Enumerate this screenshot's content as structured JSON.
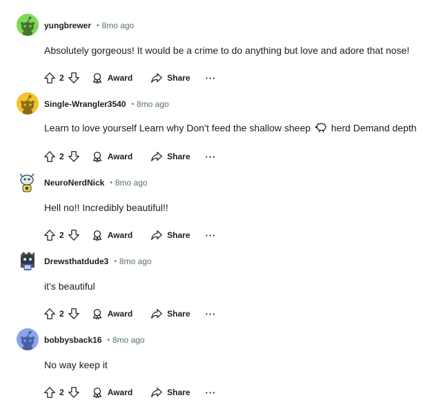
{
  "comments": [
    {
      "username": "yungbrewer",
      "separator": "•",
      "time": "8mo ago",
      "body": "Absolutely gorgeous! It would be a crime to do anything but love and adore that nose!",
      "votes": "2",
      "avatar_color": "#7ed957",
      "avatar_icon": "snoo-avatar-green"
    },
    {
      "username": "Single-Wrangler3540",
      "separator": "•",
      "time": "8mo ago",
      "body_before": "Learn to love yourself Learn why Don’t feed the shallow sheep",
      "body_icon": "sheep-emoji",
      "body_after": "herd Demand depth",
      "votes": "2",
      "avatar_color": "#f2c230",
      "avatar_icon": "snoo-avatar-yellow"
    },
    {
      "username": "NeuroNerdNick",
      "separator": "•",
      "time": "8mo ago",
      "body": "Hell no!! Incredibly beautiful!!",
      "votes": "2",
      "avatar_color": "#ffffff",
      "avatar_icon": "custom-snoo-avatar"
    },
    {
      "username": "Drewsthatdude3",
      "separator": "•",
      "time": "8mo ago",
      "body": "it’s beautiful",
      "votes": "2",
      "avatar_color": "#2f3a4d",
      "avatar_icon": "custom-snoo-avatar-dark"
    },
    {
      "username": "bobbysback16",
      "separator": "•",
      "time": "8mo ago",
      "body": "No way keep it",
      "votes": "2",
      "avatar_color": "#8da4e8",
      "avatar_icon": "snoo-avatar-blue"
    }
  ],
  "actions": {
    "award_label": "Award",
    "share_label": "Share",
    "more_label": "···"
  }
}
